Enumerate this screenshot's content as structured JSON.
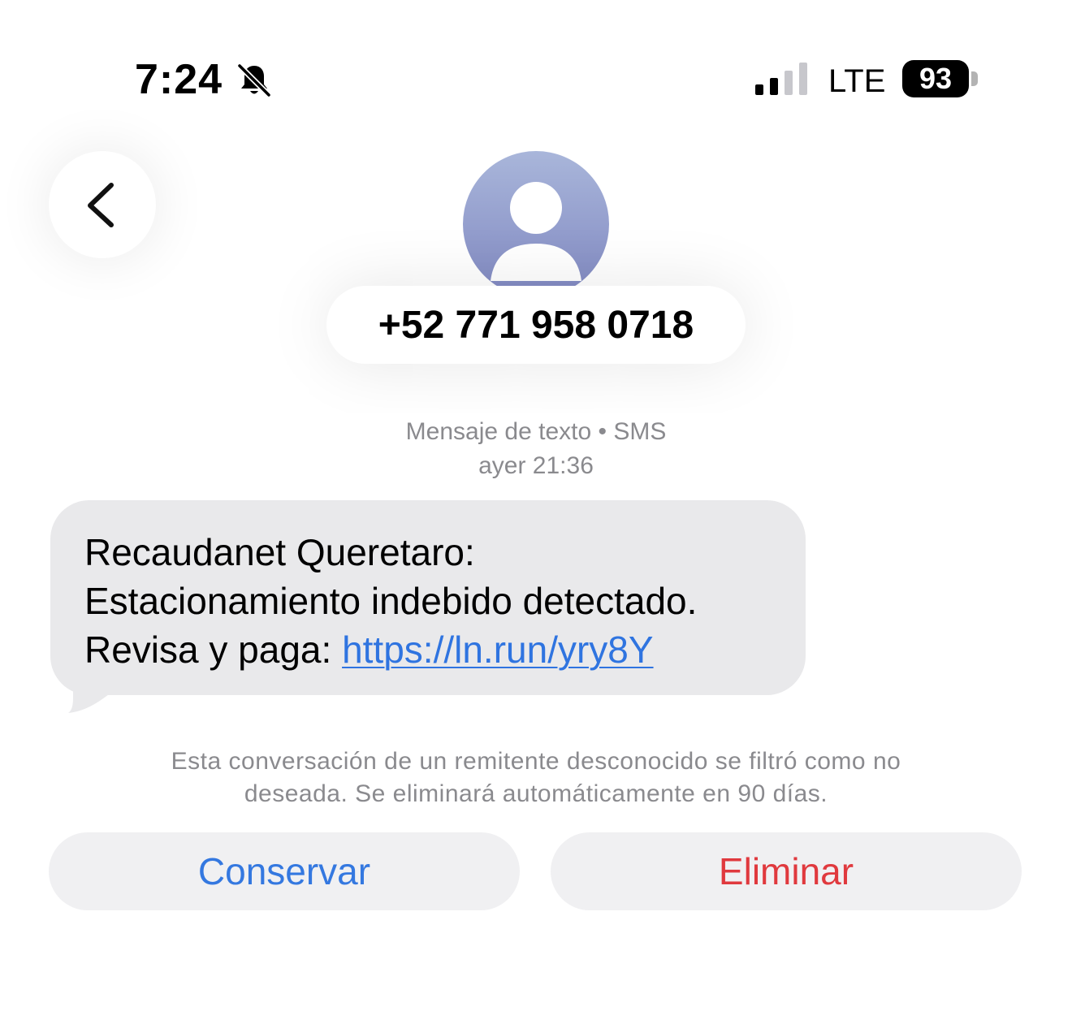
{
  "status_bar": {
    "time": "7:24",
    "network": "LTE",
    "battery": "93",
    "icons": [
      "bell-slash-icon",
      "signal-icon"
    ]
  },
  "header": {
    "back_icon": "chevron-left-icon",
    "avatar_icon": "person-icon",
    "contact": "+52 771 958 0718"
  },
  "conversation": {
    "service_label": "Mensaje de texto • SMS",
    "timestamp": "ayer 21:36",
    "message": {
      "line1": "Recaudanet Queretaro:",
      "line2": "Estacionamiento indebido detectado.",
      "line3_prefix": "Revisa y paga: ",
      "link": "https://ln.run/yry8Y"
    },
    "notice_line1": "Esta conversación de un remitente desconocido se filtró como no",
    "notice_line2": "deseada. Se eliminará automáticamente en 90 días."
  },
  "actions": {
    "keep_label": "Conservar",
    "delete_label": "Eliminar"
  },
  "colors": {
    "link": "#2f74e0",
    "keep": "#3478e0",
    "delete": "#e0393e",
    "bubble": "#e9e9eb"
  }
}
